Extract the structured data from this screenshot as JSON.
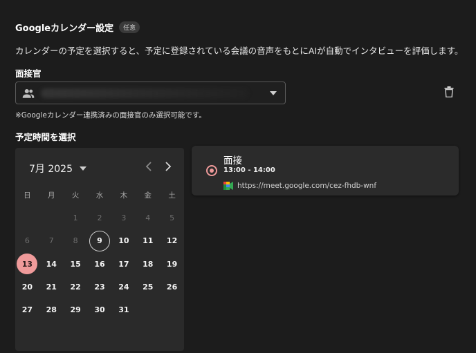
{
  "header": {
    "title": "Googleカレンダー設定",
    "badge": "任意",
    "description": "カレンダーの予定を選択すると、予定に登録されている会議の音声をもとにAIが自動でインタビューを評価します。"
  },
  "interviewer": {
    "label": "面接官",
    "note": "※Googleカレンダー連携済みの面接官のみ選択可能です。"
  },
  "schedule": {
    "label": "予定時間を選択"
  },
  "calendar": {
    "month_label": "7月 2025",
    "weekdays": [
      "日",
      "月",
      "火",
      "水",
      "木",
      "金",
      "土"
    ],
    "days": [
      {
        "label": "",
        "state": "empty"
      },
      {
        "label": "",
        "state": "empty"
      },
      {
        "label": "1",
        "state": "disabled"
      },
      {
        "label": "2",
        "state": "disabled"
      },
      {
        "label": "3",
        "state": "disabled"
      },
      {
        "label": "4",
        "state": "disabled"
      },
      {
        "label": "5",
        "state": "disabled"
      },
      {
        "label": "6",
        "state": "disabled"
      },
      {
        "label": "7",
        "state": "disabled"
      },
      {
        "label": "8",
        "state": "disabled"
      },
      {
        "label": "9",
        "state": "today"
      },
      {
        "label": "10",
        "state": "normal"
      },
      {
        "label": "11",
        "state": "normal"
      },
      {
        "label": "12",
        "state": "normal"
      },
      {
        "label": "13",
        "state": "selected"
      },
      {
        "label": "14",
        "state": "normal"
      },
      {
        "label": "15",
        "state": "normal"
      },
      {
        "label": "16",
        "state": "normal"
      },
      {
        "label": "17",
        "state": "normal"
      },
      {
        "label": "18",
        "state": "normal"
      },
      {
        "label": "19",
        "state": "normal"
      },
      {
        "label": "20",
        "state": "normal"
      },
      {
        "label": "21",
        "state": "normal"
      },
      {
        "label": "22",
        "state": "normal"
      },
      {
        "label": "23",
        "state": "normal"
      },
      {
        "label": "24",
        "state": "normal"
      },
      {
        "label": "25",
        "state": "normal"
      },
      {
        "label": "26",
        "state": "normal"
      },
      {
        "label": "27",
        "state": "normal"
      },
      {
        "label": "28",
        "state": "normal"
      },
      {
        "label": "29",
        "state": "normal"
      },
      {
        "label": "30",
        "state": "normal"
      },
      {
        "label": "31",
        "state": "normal"
      }
    ]
  },
  "event": {
    "title": "面接",
    "time": "13:00 - 14:00",
    "link": "https://meet.google.com/cez-fhdb-wnf"
  },
  "colors": {
    "accent": "#ef9a9a",
    "background": "#1c1c1c",
    "panel": "#2a2a2a"
  },
  "icons": [
    "person-group-icon",
    "chevron-down-icon",
    "trash-icon",
    "chevron-left-icon",
    "chevron-right-icon",
    "google-meet-icon"
  ]
}
